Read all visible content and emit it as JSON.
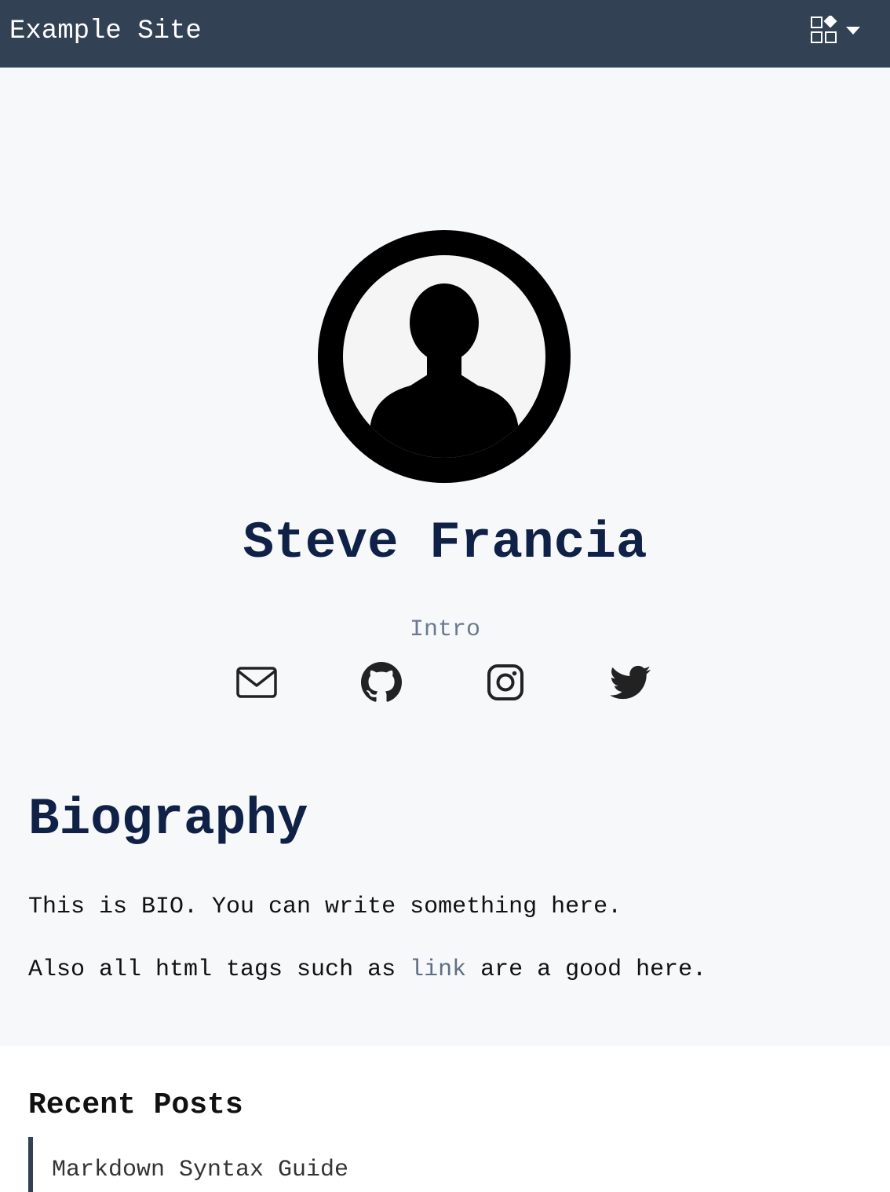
{
  "header": {
    "site_title": "Example Site",
    "menu_icon": "grid-shapes-icon",
    "menu_caret_icon": "caret-down-icon"
  },
  "profile": {
    "avatar_icon": "user-silhouette-icon",
    "name": "Steve Francia",
    "intro": "Intro",
    "social": [
      {
        "icon": "email-icon"
      },
      {
        "icon": "github-icon"
      },
      {
        "icon": "instagram-icon"
      },
      {
        "icon": "twitter-icon"
      }
    ]
  },
  "biography": {
    "heading": "Biography",
    "paragraph1": "This is BIO. You can write something here.",
    "paragraph2_before": "Also all html tags such as ",
    "paragraph2_link": "link",
    "paragraph2_after": " are a good here."
  },
  "recent_posts": {
    "heading": "Recent Posts",
    "items": [
      {
        "title": "Markdown Syntax Guide"
      }
    ]
  },
  "colors": {
    "header_bg": "#334155",
    "heading": "#0f2147",
    "muted": "#6b7a90"
  }
}
